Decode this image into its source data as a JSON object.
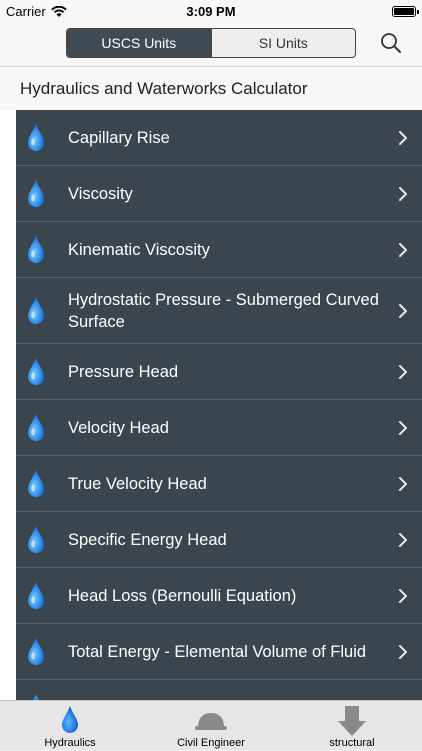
{
  "status": {
    "carrier": "Carrier",
    "time": "3:09 PM"
  },
  "nav": {
    "segments": [
      {
        "label": "USCS Units",
        "active": true
      },
      {
        "label": "SI Units",
        "active": false
      }
    ]
  },
  "header": {
    "title": "Hydraulics and Waterworks Calculator"
  },
  "list": {
    "items": [
      {
        "label": "Capillary Rise"
      },
      {
        "label": "Viscosity"
      },
      {
        "label": "Kinematic Viscosity"
      },
      {
        "label": "Hydrostatic Pressure - Submerged Curved Surface"
      },
      {
        "label": "Pressure Head"
      },
      {
        "label": "Velocity Head"
      },
      {
        "label": "True Velocity Head"
      },
      {
        "label": "Specific Energy Head"
      },
      {
        "label": "Head Loss (Bernoulli Equation)"
      },
      {
        "label": "Total Energy - Elemental Volume of Fluid"
      }
    ]
  },
  "tabs": [
    {
      "label": "Hydraulics",
      "icon": "water-drop-icon"
    },
    {
      "label": "Civil Engineer",
      "icon": "hard-hat-icon"
    },
    {
      "label": "structural",
      "icon": "down-arrow-icon"
    }
  ],
  "colors": {
    "list_background": "#3b454d",
    "segment_active": "#3f4a52",
    "drop_blue": "#2a8fe0"
  }
}
